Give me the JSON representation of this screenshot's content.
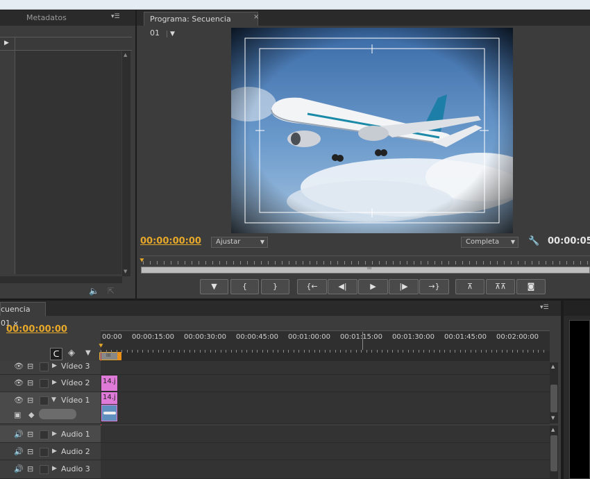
{
  "source_panel": {
    "tab_metadata": "Metadatos"
  },
  "program_monitor": {
    "tab_label": "Programa: Secuencia 01",
    "timecode": "00:00:00:00",
    "fit_select": "Ajustar",
    "quality_select": "Completa",
    "duration": "00:00:05:",
    "buttons": [
      {
        "name": "add-marker-button",
        "glyph": "⯆"
      },
      {
        "name": "mark-in-button",
        "glyph": "{"
      },
      {
        "name": "mark-out-button",
        "glyph": "}"
      },
      {
        "name": "go-to-in-button",
        "glyph": "{←"
      },
      {
        "name": "step-back-button",
        "glyph": "◀|"
      },
      {
        "name": "play-button",
        "glyph": "▶"
      },
      {
        "name": "step-forward-button",
        "glyph": "|▶"
      },
      {
        "name": "go-to-out-button",
        "glyph": "→}"
      },
      {
        "name": "lift-button",
        "glyph": "⏏"
      },
      {
        "name": "extract-button",
        "glyph": "⏏"
      },
      {
        "name": "export-frame-button",
        "glyph": "📷"
      }
    ]
  },
  "timeline": {
    "tab_label": "cuencia 01",
    "timecode": "00:00:00:00",
    "ruler": [
      "00:00",
      "00:00:15:00",
      "00:00:30:00",
      "00:00:45:00",
      "00:01:00:00",
      "00:01:15:00",
      "00:01:30:00",
      "00:01:45:00",
      "00:02:00:00"
    ],
    "work_area_label": "III",
    "tracks": [
      {
        "name": "Vídeo 3",
        "clip": ""
      },
      {
        "name": "Vídeo 2",
        "clip": "14.j"
      },
      {
        "name": "Vídeo 1",
        "clip": "14.j"
      },
      {
        "name": "Audio 1",
        "clip": ""
      },
      {
        "name": "Audio 2",
        "clip": ""
      },
      {
        "name": "Audio 3",
        "clip": ""
      }
    ]
  },
  "scrollbar_label": "III",
  "colors": {
    "timecode": "#e6a82a",
    "clip_pink": "#e07ad8",
    "panel_bg": "#3c3c3c"
  }
}
